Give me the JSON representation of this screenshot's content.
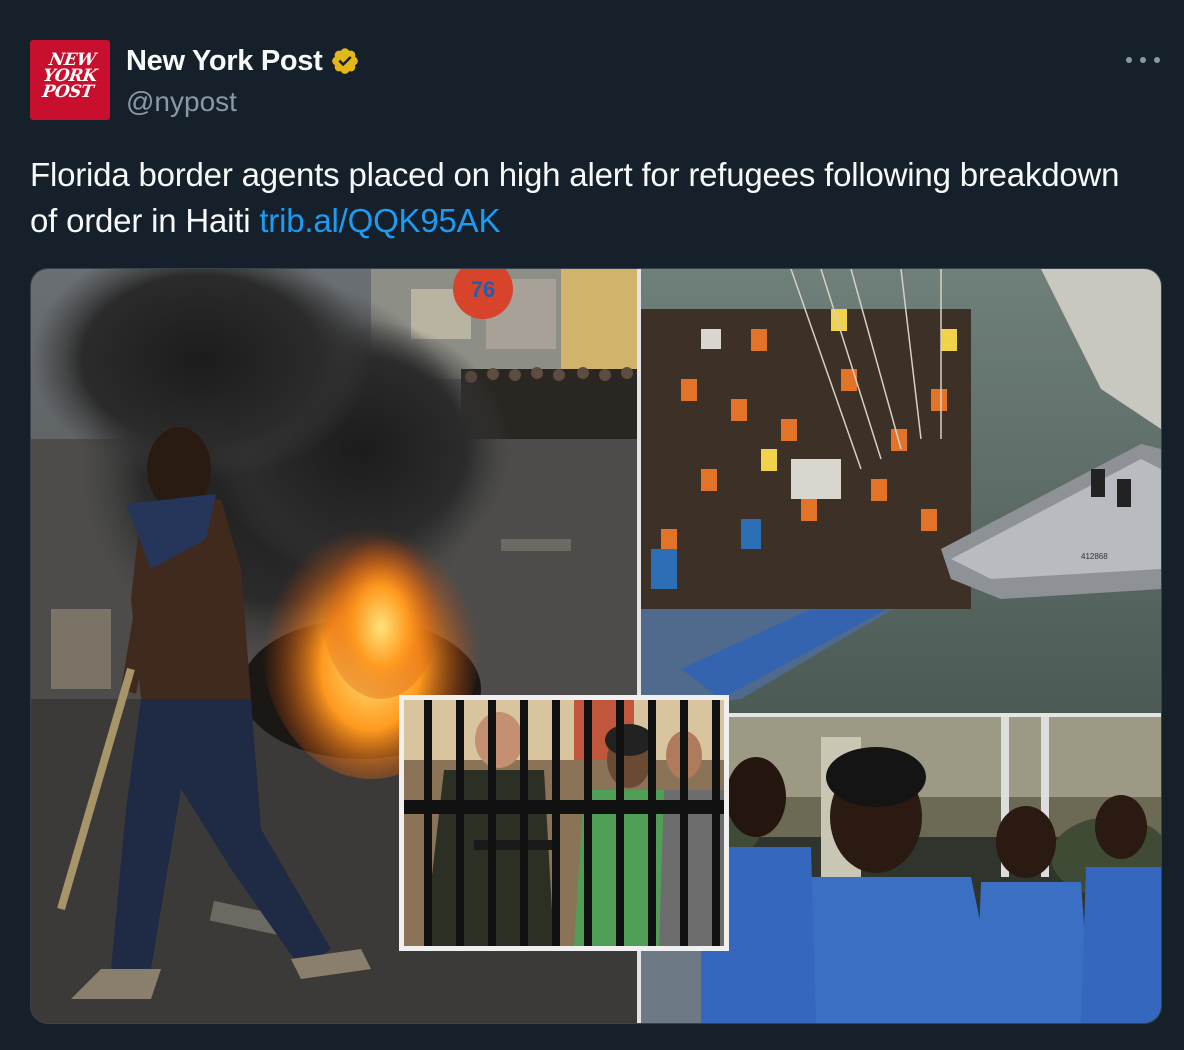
{
  "account": {
    "name": "New York Post",
    "handle": "@nypost",
    "logo_lines": [
      "NEW",
      "YORK",
      "POST"
    ],
    "logo_color": "#c8102e",
    "verified_badge_icon": "gold-verified-badge-icon",
    "verified_color": "#e2b719"
  },
  "menu": {
    "icon": "more-horizontal-icon"
  },
  "tweet": {
    "text": "Florida border agents placed on high alert for refugees following breakdown of order in Haiti ",
    "link": "trib.al/QQK95AK",
    "link_color": "#1d9bf0"
  },
  "media": {
    "photos": [
      "boy-walking-past-burning-tire-street",
      "overcrowded-boat-with-refugees-and-patrol-vessel",
      "border-agent-behind-bars",
      "young-men-in-blue-scrubs"
    ],
    "boat_number": "412868",
    "sign_number": "76"
  },
  "theme": {
    "background": "#15202b",
    "text": "#f7f9f9",
    "secondary": "#8b98a5"
  }
}
